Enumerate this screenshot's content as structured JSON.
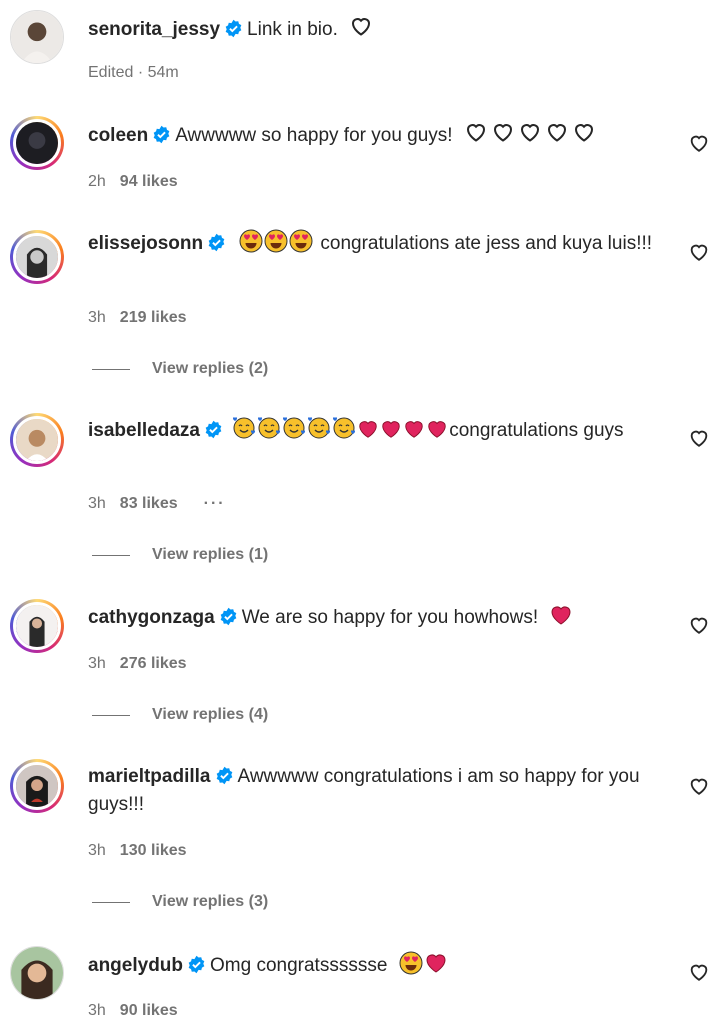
{
  "caption": {
    "username": "senorita_jessy",
    "text": "Link in bio.",
    "edited": "Edited · 54m"
  },
  "comments": [
    {
      "username": "coleen",
      "text": "Awwwww so happy for you guys!",
      "time": "2h",
      "likes": "94 likes"
    },
    {
      "username": "elissejosonn",
      "text": "congratulations ate jess and kuya luis!!!",
      "time": "3h",
      "likes": "219 likes",
      "replies": "View replies (2)"
    },
    {
      "username": "isabelledaza",
      "text": "congratulations guys",
      "time": "3h",
      "likes": "83 likes",
      "more": "···",
      "replies": "View replies (1)"
    },
    {
      "username": "cathygonzaga",
      "text": "We are so happy for you howhows!",
      "time": "3h",
      "likes": "276 likes",
      "replies": "View replies (4)"
    },
    {
      "username": "marieltpadilla",
      "text": "Awwwww congratulations i am so happy for you guys!!!",
      "time": "3h",
      "likes": "130 likes",
      "replies": "View replies (3)"
    },
    {
      "username": "angelydub",
      "text": "Omg congratsssssse",
      "time": "3h",
      "likes": "90 likes"
    }
  ],
  "colors": {
    "verified": "#0095f6",
    "heart_red": "#e0245e",
    "emoji_yellow": "#f7c02b"
  },
  "icons": [
    "verified-badge-icon",
    "heart-outline-icon",
    "heart-like-icon",
    "heart-eyes-emoji",
    "smiling-face-hearts-emoji",
    "red-heart-emoji"
  ]
}
